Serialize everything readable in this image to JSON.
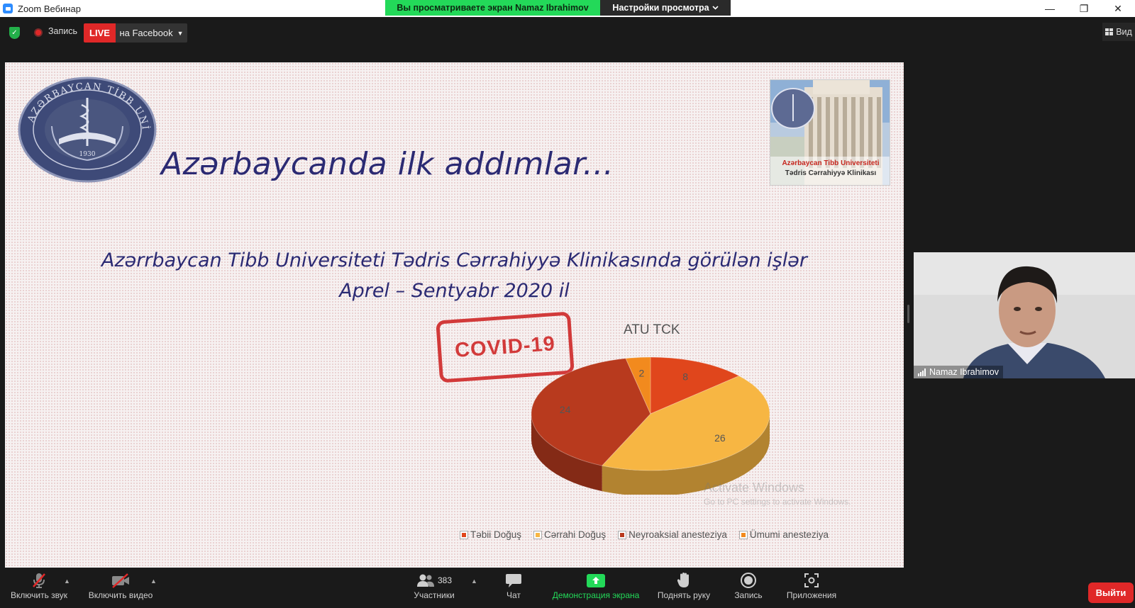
{
  "window": {
    "title": "Zoom Вебинар",
    "controls": {
      "minimize": "—",
      "restore": "❐",
      "close": "✕"
    }
  },
  "share_banner": {
    "viewing_text": "Вы просматриваете экран Namaz Ibrahimov",
    "view_options": "Настройки просмотра"
  },
  "topbar": {
    "recording_label": "Запись",
    "live_badge": "LIVE",
    "live_destination": "на Facebook",
    "view_label": "Вид"
  },
  "slide": {
    "title": "Azərbaycanda ilk addımlar...",
    "subtitle_line1": "Azərrbaycan Tibb Universiteti Tədris Cərrahiyyə Klinikasında görülən işlər",
    "subtitle_line2": "Aprel – Sentyabr 2020 il",
    "stamp_text": "COVID-19",
    "seal_text_top": "AZƏRBAYCAN TİBB UNİVERSİTETİ",
    "seal_year": "1930",
    "clinic_caption1": "Azərbaycan Tibb Universiteti",
    "clinic_caption2": "Tədris Cərrahiyyə Klinikası"
  },
  "chart_data": {
    "type": "pie",
    "title": "ATU TCK",
    "categories": [
      "Təbii Doğuş",
      "Cərrahi Doğuş",
      "Neyroaksial anesteziya",
      "Ümumi anesteziya"
    ],
    "values": [
      8,
      26,
      24,
      2
    ],
    "colors": [
      "#e0461c",
      "#f7b643",
      "#b83a1e",
      "#f28a1e"
    ],
    "legend": "bottom"
  },
  "watermark": {
    "line1": "Activate Windows",
    "line2": "Go to PC settings to activate Windows."
  },
  "participant": {
    "name": "Namaz Ibrahimov"
  },
  "toolbar": {
    "mute_label": "Включить звук",
    "video_label": "Включить видео",
    "participants_label": "Участники",
    "participants_count": "383",
    "chat_label": "Чат",
    "share_label": "Демонстрация экрана",
    "raise_hand_label": "Поднять руку",
    "record_label": "Запись",
    "apps_label": "Приложения",
    "leave_label": "Выйти"
  },
  "colors": {
    "brand_blue": "#2d8cff",
    "share_green": "#23d959",
    "live_red": "#e02828",
    "slide_text": "#2b2a73"
  }
}
